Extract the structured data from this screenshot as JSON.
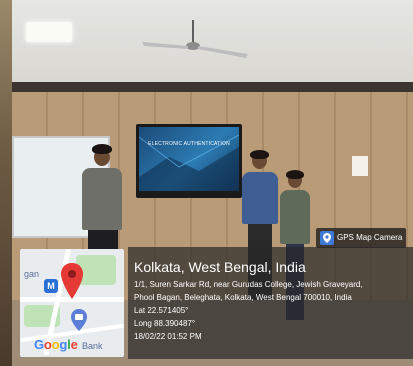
{
  "tv_screen": {
    "title": "ELECTRONIC AUTHENTICATION"
  },
  "gps_badge": {
    "label": "GPS Map Camera",
    "icon": "camera-pin-icon"
  },
  "location": {
    "title": "Kolkata, West Bengal, India",
    "address_line1": "1/1, Suren Sarkar Rd, near Gurudas College, Jewish Graveyard,",
    "address_line2": "Phool Bagan, Beleghata, Kolkata, West Bengal 700010, India",
    "lat": "Lat 22.571405°",
    "long": "Long 88.390487°",
    "datetime": "18/02/22 01:52 PM"
  },
  "map": {
    "label_top": "gan",
    "label_bottom": "Bank",
    "metro_badge": "M",
    "google_letters": [
      "G",
      "o",
      "o",
      "g",
      "l",
      "e"
    ],
    "google_colors": [
      "#4285f4",
      "#ea4335",
      "#fbbc05",
      "#4285f4",
      "#34a853",
      "#ea4335"
    ],
    "pin_color": "#e53935"
  }
}
